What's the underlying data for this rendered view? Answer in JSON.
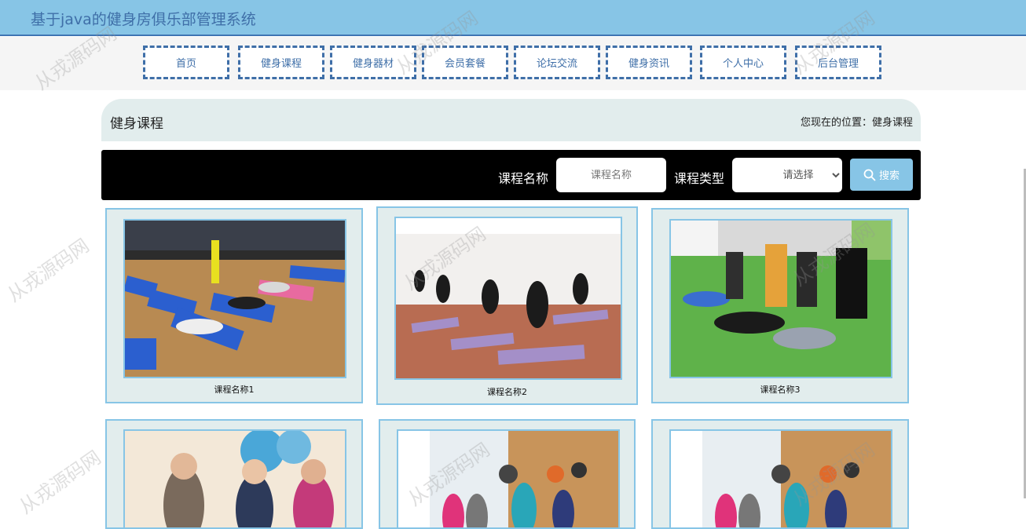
{
  "header": {
    "title": "基于java的健身房俱乐部管理系统"
  },
  "nav": [
    {
      "label": "首页"
    },
    {
      "label": "健身课程"
    },
    {
      "label": "健身器材"
    },
    {
      "label": "会员套餐"
    },
    {
      "label": "论坛交流"
    },
    {
      "label": "健身资讯"
    },
    {
      "label": "个人中心"
    },
    {
      "label": "后台管理"
    }
  ],
  "page": {
    "title": "健身课程",
    "location": "您现在的位置：健身课程"
  },
  "search": {
    "name_label": "课程名称",
    "name_placeholder": "课程名称",
    "type_label": "课程类型",
    "type_selected": "请选择",
    "button_label": "搜索"
  },
  "courses": [
    {
      "name": "课程名称1"
    },
    {
      "name": "课程名称2"
    },
    {
      "name": "课程名称3"
    },
    {
      "name": ""
    },
    {
      "name": ""
    },
    {
      "name": ""
    }
  ],
  "watermark": "从戎源码网",
  "colors": {
    "accent": "#87c5e6",
    "nav_border": "#3f6fa8",
    "panel": "#e2eded",
    "search_bg": "#000000"
  }
}
